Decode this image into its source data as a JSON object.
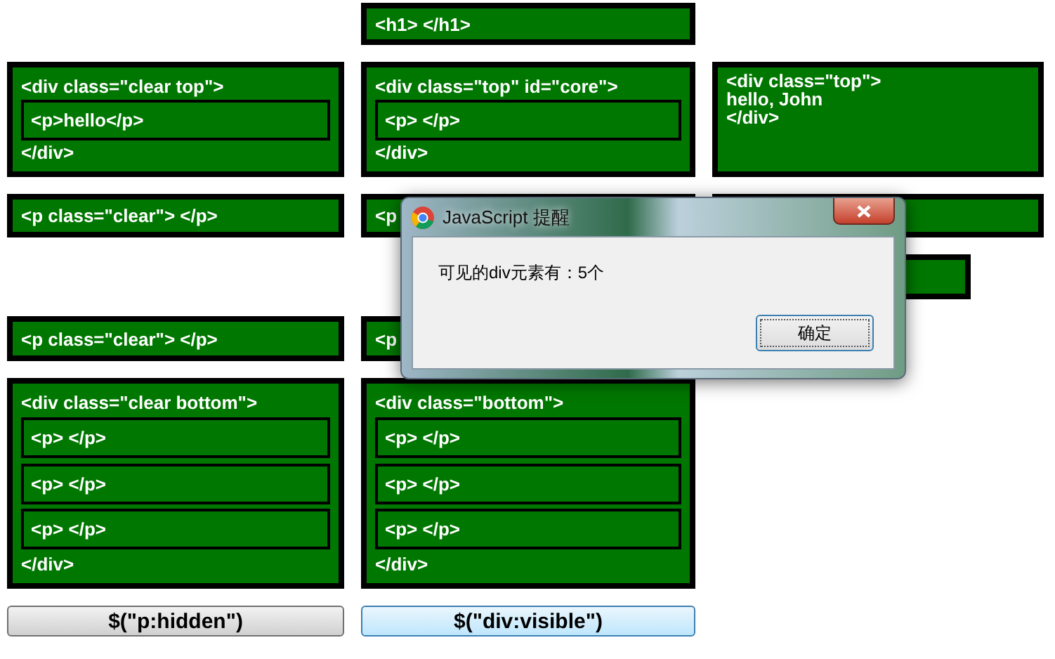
{
  "rows": [
    {
      "cells": [
        {
          "kind": "blank"
        },
        {
          "kind": "tag",
          "text": "<h1> </h1>"
        },
        {
          "kind": "blank"
        }
      ]
    },
    {
      "cells": [
        {
          "kind": "container",
          "open": "<div class=\"clear top\">",
          "children": [
            "<p>hello</p>"
          ],
          "close": "</div>"
        },
        {
          "kind": "container",
          "open": "<div class=\"top\" id=\"core\">",
          "children": [
            "<p> </p>"
          ],
          "close": "</div>"
        },
        {
          "kind": "lines",
          "lines": [
            "<div class=\"top\">",
            "hello, John",
            "</div>"
          ]
        }
      ]
    },
    {
      "cells": [
        {
          "kind": "tag",
          "text": "<p class=\"clear\"> </p>"
        },
        {
          "kind": "tag",
          "text": "<p"
        },
        {
          "kind": "tag"
        }
      ]
    },
    {
      "cells": [
        {
          "kind": "blank"
        },
        {
          "kind": "blank"
        },
        {
          "kind": "short"
        }
      ]
    },
    {
      "cells": [
        {
          "kind": "tag",
          "text": "<p class=\"clear\"> </p>"
        },
        {
          "kind": "tag",
          "text": "<p"
        },
        {
          "kind": "blank"
        }
      ]
    },
    {
      "cells": [
        {
          "kind": "container",
          "open": "<div class=\"clear bottom\">",
          "children": [
            "<p> </p>",
            "<p> </p>",
            "<p> </p>"
          ],
          "close": "</div>"
        },
        {
          "kind": "container",
          "open": "<div class=\"bottom\">",
          "children": [
            "<p> </p>",
            "<p> </p>",
            "<p> </p>"
          ],
          "close": "</div>"
        },
        {
          "kind": "blank"
        }
      ]
    }
  ],
  "buttons": [
    {
      "label": "$(\"p:hidden\")",
      "highlighted": false
    },
    {
      "label": "$(\"div:visible\")",
      "highlighted": true
    }
  ],
  "dialog": {
    "title": "JavaScript 提醒",
    "message": "可见的div元素有：5个",
    "ok": "确定"
  }
}
